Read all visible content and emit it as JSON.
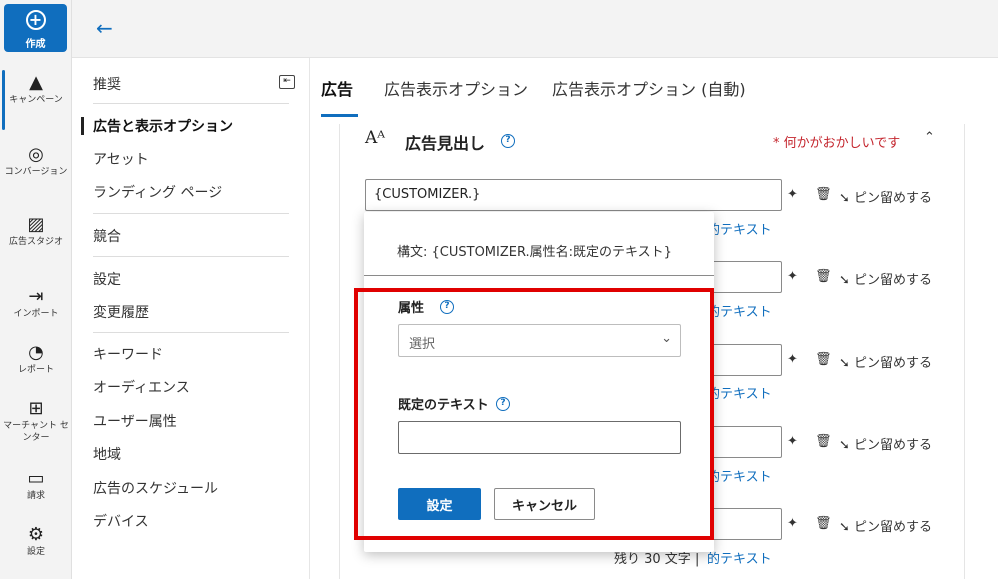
{
  "rail": {
    "create_label": "作成",
    "items": [
      {
        "label": "キャンペーン",
        "icon": "megaphone-icon",
        "glyph": "📣"
      },
      {
        "label": "コンバージョン",
        "icon": "target-icon",
        "glyph": "◎"
      },
      {
        "label": "広告スタジオ",
        "icon": "image-edit-icon",
        "glyph": "▨"
      },
      {
        "label": "インポート",
        "icon": "import-icon",
        "glyph": "⇥"
      },
      {
        "label": "レポート",
        "icon": "report-icon",
        "glyph": "◔"
      },
      {
        "label": "マーチャント センター",
        "icon": "gift-icon",
        "glyph": "⊞"
      },
      {
        "label": "請求",
        "icon": "wallet-icon",
        "glyph": "▭"
      },
      {
        "label": "設定",
        "icon": "gear-icon",
        "glyph": "⚙"
      }
    ]
  },
  "subnav": {
    "items": [
      "推奨",
      "広告と表示オプション",
      "アセット",
      "ランディング ページ",
      "競合",
      "設定",
      "変更履歴",
      "キーワード",
      "オーディエンス",
      "ユーザー属性",
      "地域",
      "広告のスケジュール",
      "デバイス"
    ]
  },
  "tabs": [
    "広告",
    "広告表示オプション",
    "広告表示オプション (自動)"
  ],
  "section": {
    "title": "広告見出し",
    "error": "* 何かがおかしいです"
  },
  "headline": {
    "value": "{CUSTOMIZER.}",
    "pin_label": "ピン留めする",
    "dynamic_text": "動的テキスト",
    "dynamic_text_partial": "的テキスト",
    "remaining": "残り 30 文字 |"
  },
  "dropdown": {
    "syntax": "構文: {CUSTOMIZER.属性名:既定のテキスト}",
    "attribute_label": "属性",
    "select_placeholder": "選択",
    "default_text_label": "既定のテキスト",
    "default_text_value": "",
    "apply_button": "設定",
    "cancel_button": "キャンセル"
  },
  "colors": {
    "accent": "#106ebe",
    "error": "#c4262e",
    "highlight_box": "#e00000"
  }
}
